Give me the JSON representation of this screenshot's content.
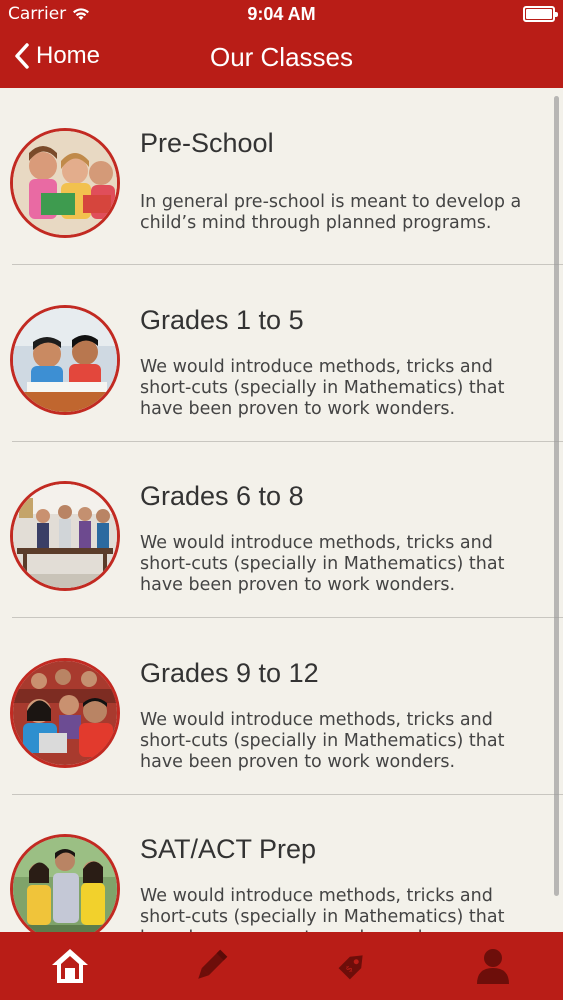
{
  "status_bar": {
    "carrier": "Carrier",
    "time": "9:04 AM"
  },
  "nav": {
    "back_label": "Home",
    "title": "Our Classes"
  },
  "classes": [
    {
      "title": "Pre-School",
      "description": "In general pre-school is meant to develop a child’s mind through planned programs."
    },
    {
      "title": "Grades 1 to 5",
      "description": "We would introduce methods, tricks and short-cuts (specially in Mathematics) that have been proven to work wonders."
    },
    {
      "title": "Grades 6 to 8",
      "description": "We would introduce methods, tricks and short-cuts (specially in Mathematics) that have been proven to work wonders."
    },
    {
      "title": "Grades 9 to 12",
      "description": "We would introduce methods, tricks and short-cuts (specially in Mathematics) that have been proven to work wonders."
    },
    {
      "title": "SAT/ACT Prep",
      "description": "We would introduce methods, tricks and short-cuts (specially in Mathematics) that have been proven to work wonders."
    }
  ],
  "tabs": [
    {
      "icon": "home-icon"
    },
    {
      "icon": "pencil-icon"
    },
    {
      "icon": "tag-icon"
    },
    {
      "icon": "user-icon"
    }
  ],
  "colors": {
    "brand": "#b91d17",
    "background": "#f3f1ea",
    "text": "#333333"
  }
}
